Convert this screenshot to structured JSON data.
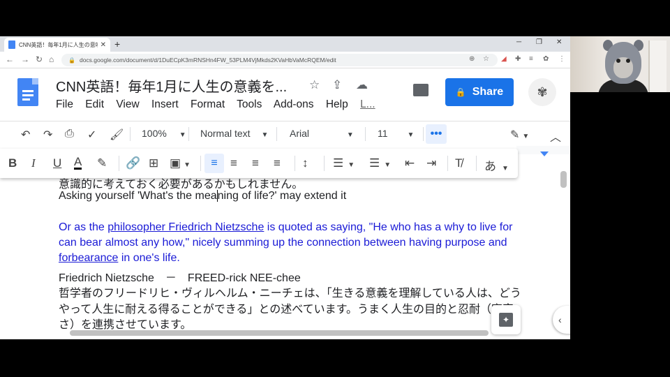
{
  "browser": {
    "tab_title": "CNN英語！毎年1月に人生の意味を",
    "url": "docs.google.com/document/d/1DuECpK3mRNSHn4FW_53PLM4VjMkds2KVaHbVaMcRQEM/edit"
  },
  "docs": {
    "title": "CNN英語！毎年1月に人生の意義を...",
    "share_label": "Share",
    "menu": [
      "File",
      "Edit",
      "View",
      "Insert",
      "Format",
      "Tools",
      "Add-ons",
      "Help",
      "L..."
    ]
  },
  "toolbar": {
    "zoom": "100%",
    "style": "Normal text",
    "font": "Arial",
    "size": "11",
    "more": "•••"
  },
  "format_bar": {
    "bold": "B",
    "italic": "I",
    "underline": "U",
    "text_color": "A",
    "input_tools": "あ"
  },
  "document": {
    "line1": "意識的に考えておく必要があるかもしれません。",
    "line2a": "Asking yourself 'What's the mea",
    "line2b": "ning of life?' may extend it",
    "p2_l1_pre": "Or as the ",
    "p2_l1_link": "philosopher Friedrich Nietzsche",
    "p2_l1_post": " is quoted as saying, \"He who has a why to live for",
    "p2_l2": "can bear almost any how,\" nicely summing up the connection between having purpose and",
    "p2_l3_link": "forbearance",
    "p2_l3_post": " in one's life.",
    "p3": "Friedrich Nietzsche　－　FREED-rick NEE-chee",
    "p4_l1": "哲学者のフリードリヒ・ヴィルヘルム・ニーチェは、「生きる意義を理解している人は、どう",
    "p4_l2": "やって人生に耐える得ることができる」との述べています。うまく人生の目的と忍耐（寛容",
    "p4_l3": "さ）を連携させています。"
  },
  "colors": {
    "share_blue": "#1a73e8",
    "link_blue": "#1a1ad6",
    "docs_blue": "#4285f4"
  }
}
